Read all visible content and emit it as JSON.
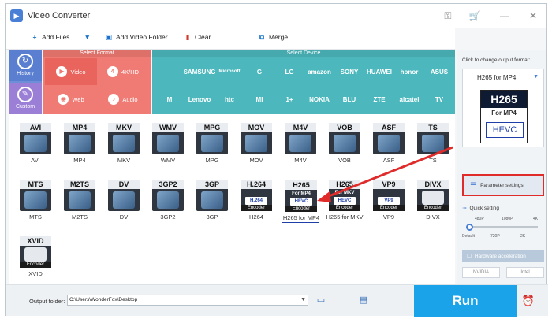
{
  "app": {
    "title": "Video Converter"
  },
  "toolbar": {
    "add_files": "Add Files",
    "add_video_folder": "Add Video Folder",
    "clear": "Clear",
    "merge": "Merge"
  },
  "categories": {
    "select_format": "Select Format",
    "select_device": "Select Device",
    "side": [
      {
        "label": "History",
        "icon": "history-icon"
      },
      {
        "label": "Custom",
        "icon": "custom-icon"
      }
    ],
    "formats": [
      {
        "label": "Video",
        "icon": "play-icon"
      },
      {
        "label": "4K/HD",
        "icon": "4k-icon"
      },
      {
        "label": "Web",
        "icon": "web-icon"
      },
      {
        "label": "Audio",
        "icon": "audio-icon"
      }
    ],
    "devices_row1": [
      "",
      "SAMSUNG",
      "Microsoft",
      "G",
      "LG",
      "amazon",
      "SONY",
      "HUAWEI",
      "honor",
      "ASUS"
    ],
    "devices_row2": [
      "",
      "Lenovo",
      "htc",
      "MI",
      "1+",
      "NOKIA",
      "BLU",
      "ZTE",
      "alcatel",
      "TV"
    ]
  },
  "formats_grid": [
    {
      "tag": "AVI",
      "label": "AVI"
    },
    {
      "tag": "MP4",
      "label": "MP4"
    },
    {
      "tag": "MKV",
      "label": "MKV"
    },
    {
      "tag": "WMV",
      "label": "WMV"
    },
    {
      "tag": "MPG",
      "label": "MPG"
    },
    {
      "tag": "MOV",
      "label": "MOV"
    },
    {
      "tag": "M4V",
      "label": "M4V"
    },
    {
      "tag": "VOB",
      "label": "VOB"
    },
    {
      "tag": "ASF",
      "label": "ASF"
    },
    {
      "tag": "TS",
      "label": "TS"
    },
    {
      "tag": "MTS",
      "label": "MTS"
    },
    {
      "tag": "M2TS",
      "label": "M2TS"
    },
    {
      "tag": "DV",
      "label": "DV"
    },
    {
      "tag": "3GP2",
      "label": "3GP2"
    },
    {
      "tag": "3GP",
      "label": "3GP"
    },
    {
      "tag": "H.264",
      "label": "H264",
      "encoder": "Encoder",
      "codec": "H.264"
    },
    {
      "tag": "H265",
      "label": "H265 for MP4",
      "encoder": "Encoder",
      "sub": "For MP4",
      "codec": "HEVC"
    },
    {
      "tag": "H265",
      "label": "H265 for MKV",
      "encoder": "Encoder",
      "sub": "For MKV",
      "codec": "HEVC"
    },
    {
      "tag": "VP9",
      "label": "VP9",
      "encoder": "Encoder",
      "codec": "VP9"
    },
    {
      "tag": "DIVX",
      "label": "DIVX",
      "encoder": "Encoder"
    },
    {
      "tag": "XVID",
      "label": "XVID",
      "encoder": "Encoder"
    }
  ],
  "output_panel": {
    "caption": "Click to change output format:",
    "selected_format": "H265 for MP4",
    "big_icon": {
      "header": "H265",
      "sub": "For MP4",
      "codec": "HEVC"
    },
    "parameter_settings": "Parameter settings",
    "quick_setting": "Quick setting",
    "slider_top": [
      "480P",
      "1080P",
      "4K"
    ],
    "slider_bottom": [
      "Default",
      "720P",
      "2K"
    ],
    "hardware_acceleration": "Hardware acceleration",
    "gpu_nvidia": "NVIDIA",
    "gpu_intel": "Intel"
  },
  "bottom": {
    "output_folder_label": "Output folder:",
    "output_folder_value": "C:\\Users\\WonderFox\\Desktop",
    "run": "Run"
  },
  "colors": {
    "accent_blue": "#1aa3e8",
    "format_red": "#f07b74",
    "device_teal": "#4cb8bd",
    "highlight_red": "#e02b2b"
  }
}
